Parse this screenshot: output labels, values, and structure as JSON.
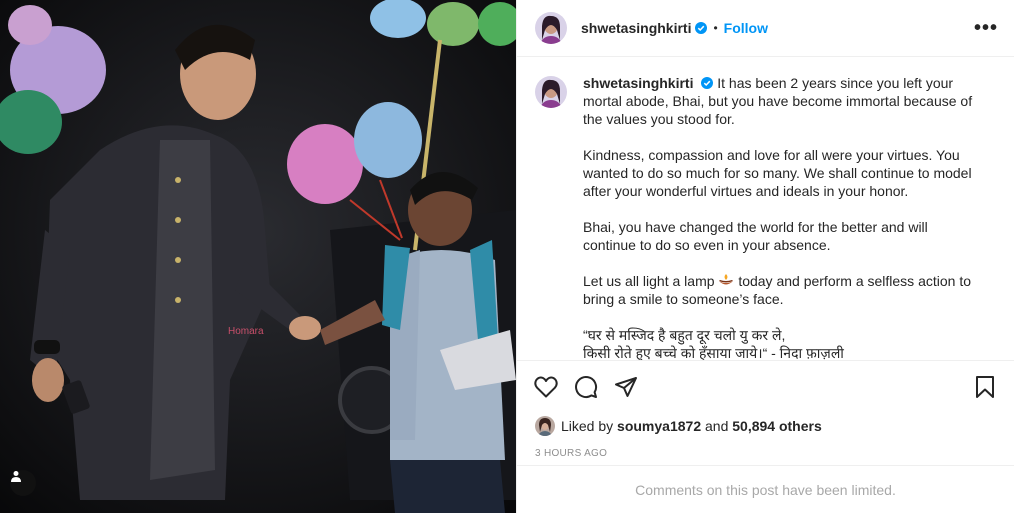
{
  "post": {
    "username": "shwetasinghkirti",
    "follow_label": "Follow",
    "separator": "•",
    "more_label": "•••",
    "caption": {
      "username": "shwetasinghkirti",
      "p1": "It has been 2 years since you left your mortal abode, Bhai, but you have become immortal because of the values you stood for.",
      "p2": "Kindness, compassion and love for all were your virtues. You wanted to do so much for so many. We shall continue to model after your wonderful virtues and ideals in your honor.",
      "p3": "Bhai, you have changed the world for the better and will continue to do so even in your absence.",
      "p4a": "Let us all light a lamp",
      "p4b": "today and perform a selfless action to bring a smile to someone’s face.",
      "p5a": "“घर से मस्जिद है बहुत दूर चलो यु कर ले,",
      "p5b": "किसी रोते हुए बच्चे को हँसाया जाये।“ - निदा फ़ाज़ली"
    },
    "likes": {
      "prefix": "Liked by",
      "user": "soumya1872",
      "and": "and",
      "others": "50,894 others"
    },
    "timestamp": "3 HOURS AGO",
    "comments_notice": "Comments on this post have been limited.",
    "photo_watermark": "Homara"
  },
  "colors": {
    "accent": "#0095f6",
    "verified": "#0095f6",
    "muted": "#8e8e8e"
  },
  "icons": [
    "verified-badge-icon",
    "heart-icon",
    "comment-icon",
    "share-icon",
    "bookmark-icon",
    "tag-user-icon",
    "lamp-icon"
  ]
}
